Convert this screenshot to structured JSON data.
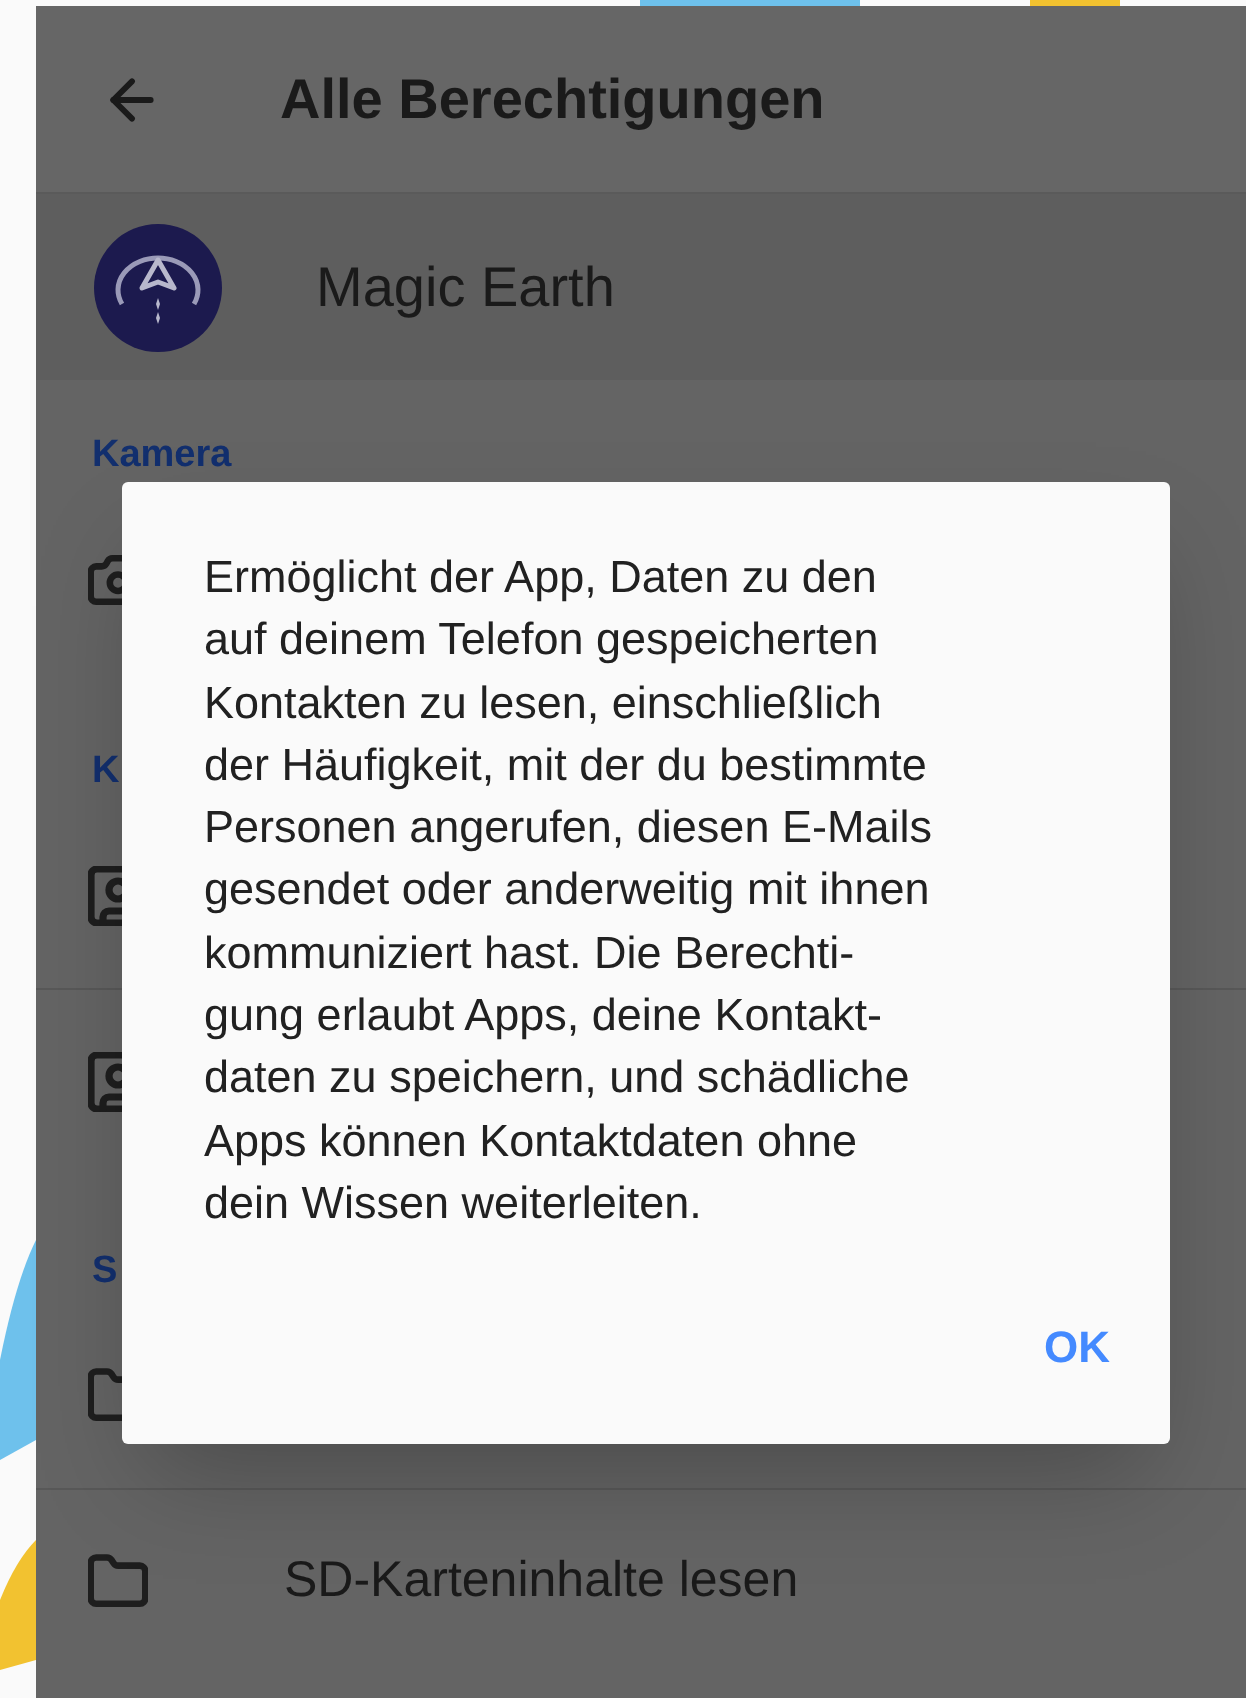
{
  "header": {
    "title": "Alle Berechtigungen"
  },
  "app": {
    "name": "Magic Earth"
  },
  "sections": [
    {
      "title": "Kamera",
      "items": [
        {
          "kind": "camera"
        }
      ]
    },
    {
      "title": "K",
      "items": [
        {
          "kind": "contact"
        },
        {
          "kind": "contact"
        }
      ]
    },
    {
      "title": "S",
      "items": [
        {
          "kind": "folder"
        },
        {
          "kind": "folder",
          "label": "SD-Karteninhalte lesen"
        }
      ]
    }
  ],
  "dialog": {
    "message_lines": [
      "Ermöglicht der App, Daten zu den",
      "auf deinem Telefon gespeicherten",
      "Kontakten zu lesen, einschließlich",
      "der Häufigkeit, mit der du bestimmte",
      "Personen angerufen, diesen E-Mails",
      "gesendet oder anderweitig mit ihnen",
      "kommuniziert hast. Die Berechti-",
      "gung erlaubt Apps, deine Kontakt-",
      "daten zu speichern, und schädliche",
      "Apps können Kontaktdaten ohne",
      "dein Wissen weiterleiten."
    ],
    "button": "OK"
  }
}
